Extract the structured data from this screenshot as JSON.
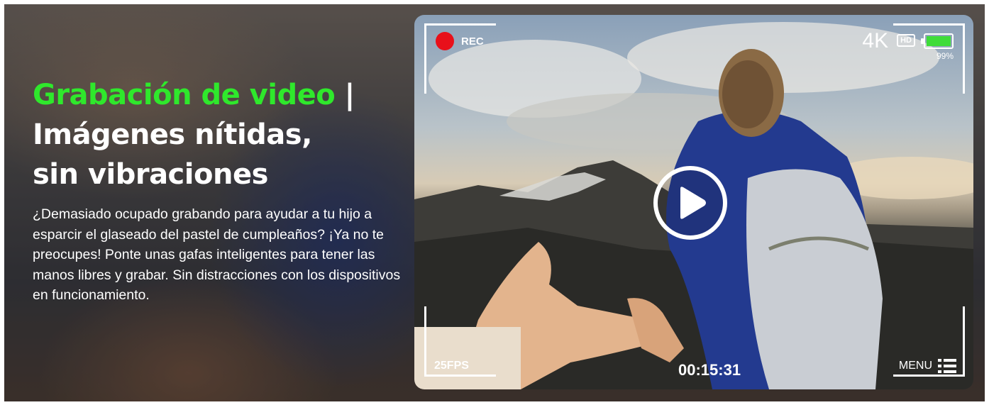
{
  "headline": {
    "highlight": "Grabación de video",
    "separator": " |",
    "line2": "Imágenes nítidas,",
    "line3": "sin vibraciones"
  },
  "description": "¿Demasiado ocupado grabando para ayudar a tu hijo a esparcir el glaseado del pastel de cumpleaños? ¡Ya no te preocupes! Ponte unas gafas inteligentes para tener las manos libres y grabar. Sin distracciones con los dispositivos en funcionamiento.",
  "viewfinder": {
    "rec_label": "REC",
    "resolution": "4K",
    "hd_badge": "HD",
    "battery_percent": "99%",
    "battery_level": 0.99,
    "fps": "25FPS",
    "timecode": "00:15:31",
    "menu_label": "MENU"
  },
  "icons": [
    "record-dot-icon",
    "hd-icon",
    "battery-icon",
    "play-icon",
    "menu-list-icon"
  ],
  "colors": {
    "headline_accent": "#2fe82c",
    "rec_dot": "#e8101a",
    "battery_fill": "#3fdc3a",
    "text": "#ffffff"
  }
}
